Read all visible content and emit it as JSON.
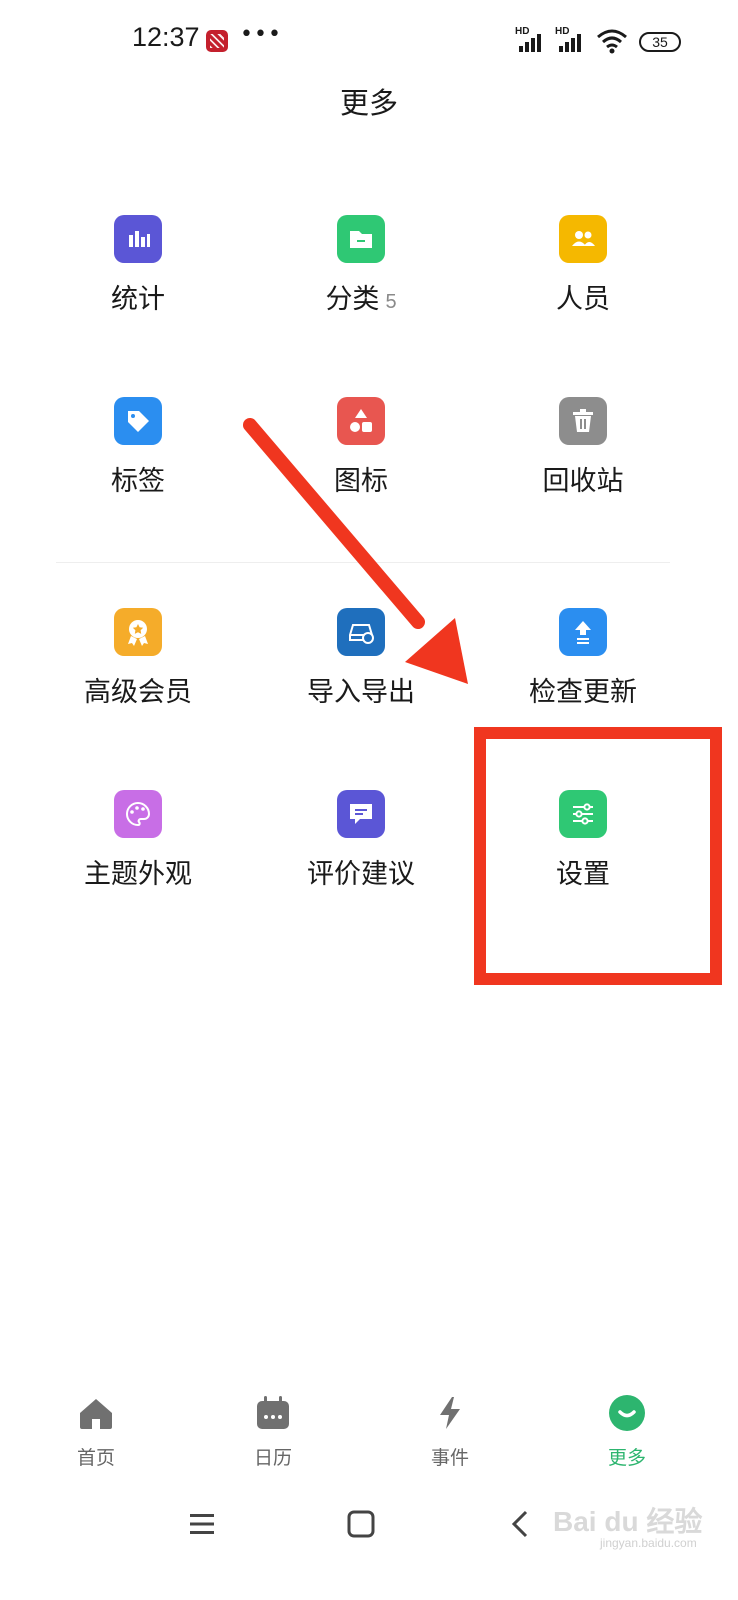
{
  "status_bar": {
    "time": "12:37",
    "dots": "•••",
    "battery": "35",
    "signal_label_1": "HD",
    "signal_label_2": "HD"
  },
  "header": {
    "title": "更多"
  },
  "grid": {
    "items": [
      {
        "label": "统计",
        "icon": "bar-chart-icon",
        "color": "#5b56d6"
      },
      {
        "label": "分类",
        "count": "5",
        "icon": "folder-icon",
        "color": "#2fc874"
      },
      {
        "label": "人员",
        "icon": "people-icon",
        "color": "#f5b800"
      },
      {
        "label": "标签",
        "icon": "tag-icon",
        "color": "#2b8ef0"
      },
      {
        "label": "图标",
        "icon": "shapes-icon",
        "color": "#e85650"
      },
      {
        "label": "回收站",
        "icon": "trash-icon",
        "color": "#8d8d8d"
      },
      {
        "label": "高级会员",
        "icon": "award-icon",
        "color": "#f5ac2a"
      },
      {
        "label": "导入导出",
        "icon": "import-export-icon",
        "color": "#1f6fbd"
      },
      {
        "label": "检查更新",
        "icon": "upload-icon",
        "color": "#2b8ef0"
      },
      {
        "label": "主题外观",
        "icon": "palette-icon",
        "color": "#c86ee6"
      },
      {
        "label": "评价建议",
        "icon": "feedback-icon",
        "color": "#5b56d6"
      },
      {
        "label": "设置",
        "icon": "sliders-icon",
        "color": "#2fc874"
      }
    ]
  },
  "annotation": {
    "color": "#f0361f"
  },
  "bottom_nav": {
    "items": [
      {
        "label": "首页",
        "icon": "home-icon"
      },
      {
        "label": "日历",
        "icon": "calendar-icon"
      },
      {
        "label": "事件",
        "icon": "lightning-icon"
      },
      {
        "label": "更多",
        "icon": "more-icon",
        "active": true
      }
    ],
    "active_color": "#2db56f"
  },
  "system_nav": {
    "icons": [
      "menu-icon",
      "home-square-icon",
      "back-icon"
    ]
  },
  "watermark": {
    "text": "Bai du 经验",
    "sub": "jingyan.baidu.com"
  }
}
